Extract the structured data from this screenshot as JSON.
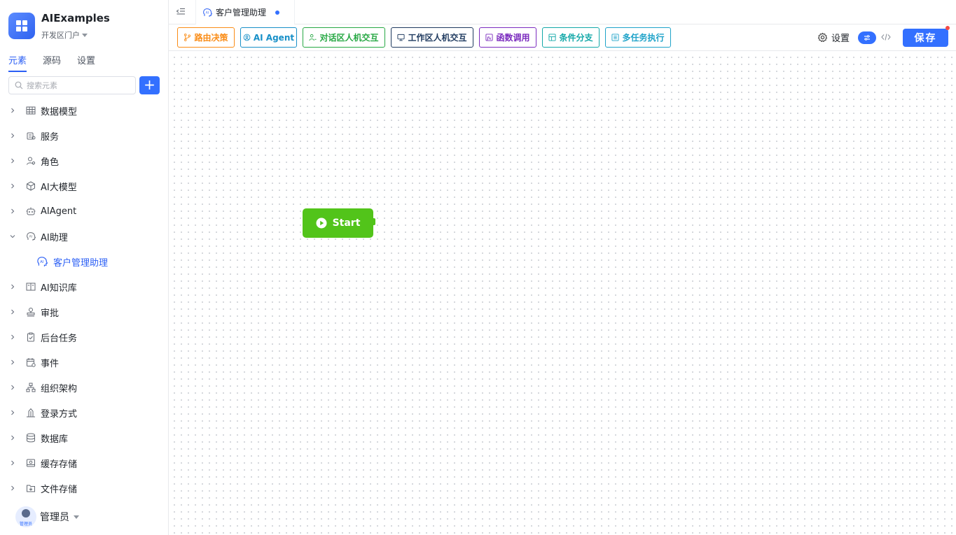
{
  "app": {
    "name": "AIExamples",
    "portal": "开发区门户"
  },
  "sidebar": {
    "tabs": [
      {
        "label": "元素",
        "active": true
      },
      {
        "label": "源码",
        "active": false
      },
      {
        "label": "设置",
        "active": false
      }
    ],
    "search": {
      "placeholder": "搜索元素"
    },
    "add_label": "+",
    "items": [
      {
        "label": "数据模型",
        "icon": "table-icon",
        "expanded": false
      },
      {
        "label": "服务",
        "icon": "service-icon",
        "expanded": false
      },
      {
        "label": "角色",
        "icon": "role-icon",
        "expanded": false
      },
      {
        "label": "AI大模型",
        "icon": "cube-icon",
        "expanded": false
      },
      {
        "label": "AIAgent",
        "icon": "robot-icon",
        "expanded": false
      },
      {
        "label": "AI助理",
        "icon": "ai-assistant-icon",
        "expanded": true,
        "children": [
          {
            "label": "客户管理助理",
            "icon": "ai-assistant-icon"
          }
        ]
      },
      {
        "label": "AI知识库",
        "icon": "book-icon",
        "expanded": false
      },
      {
        "label": "审批",
        "icon": "stamp-icon",
        "expanded": false
      },
      {
        "label": "后台任务",
        "icon": "task-icon",
        "expanded": false
      },
      {
        "label": "事件",
        "icon": "event-icon",
        "expanded": false
      },
      {
        "label": "组织架构",
        "icon": "org-icon",
        "expanded": false
      },
      {
        "label": "登录方式",
        "icon": "login-icon",
        "expanded": false
      },
      {
        "label": "数据库",
        "icon": "database-icon",
        "expanded": false
      },
      {
        "label": "缓存存储",
        "icon": "cache-icon",
        "expanded": false
      },
      {
        "label": "文件存储",
        "icon": "file-storage-icon",
        "expanded": false
      }
    ]
  },
  "user": {
    "name": "管理员",
    "avatar_label": "管理员"
  },
  "topbar": {
    "tab_title": "客户管理助理",
    "unsaved": true
  },
  "toolbar": {
    "nodes": [
      {
        "label": "路由决策",
        "color": "#fa8c16",
        "icon": "branch-icon"
      },
      {
        "label": "AI Agent",
        "color": "#1890c8",
        "icon": "agent-icon"
      },
      {
        "label": "对话区人机交互",
        "color": "#27a844",
        "icon": "user-chat-icon"
      },
      {
        "label": "工作区人机交互",
        "color": "#1f3a5f",
        "icon": "monitor-icon"
      },
      {
        "label": "函数调用",
        "color": "#7b2cbf",
        "icon": "function-icon"
      },
      {
        "label": "条件分支",
        "color": "#13a8a8",
        "icon": "condition-icon"
      },
      {
        "label": "多任务执行",
        "color": "#1fa3c9",
        "icon": "multitask-icon"
      }
    ],
    "settings_label": "设置",
    "save_label": "保存"
  },
  "canvas": {
    "start_label": "Start"
  },
  "colors": {
    "accent": "#3370ff",
    "start": "#52c41a",
    "unsaved_dot": "#f54a45"
  }
}
